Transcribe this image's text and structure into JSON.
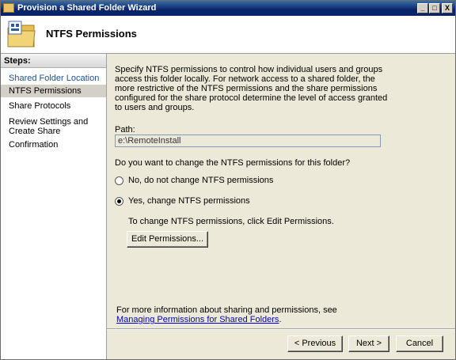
{
  "window": {
    "title": "Provision a Shared Folder Wizard",
    "controls": {
      "minimize": "_",
      "maximize": "□",
      "close": "X"
    }
  },
  "header": {
    "title": "NTFS Permissions",
    "icon": "folder-icon"
  },
  "steps": {
    "heading": "Steps:",
    "items": [
      {
        "label": "Shared Folder Location",
        "state": "done"
      },
      {
        "label": "NTFS Permissions",
        "state": "active"
      },
      {
        "label": "Share Protocols",
        "state": "pending"
      },
      {
        "label": "Review Settings and Create Share",
        "state": "pending"
      },
      {
        "label": "Confirmation",
        "state": "pending"
      }
    ]
  },
  "content": {
    "description": "Specify NTFS permissions to control how individual users and groups access this folder locally. For network access to a shared folder, the more restrictive of the NTFS permissions and the share permissions configured for the share protocol determine the level of access granted to users and groups.",
    "path_label": "Path:",
    "path_value": "e:\\RemoteInstall",
    "question": "Do you want to change the NTFS permissions for this folder?",
    "option_no": "No, do not change NTFS permissions",
    "option_yes": "Yes, change NTFS permissions",
    "selected_option": "yes",
    "hint": "To change NTFS permissions, click Edit Permissions.",
    "edit_button": "Edit Permissions...",
    "info_prefix": "For more information about sharing and permissions, see ",
    "info_link": "Managing Permissions for Shared Folders",
    "info_suffix": "."
  },
  "footer": {
    "previous": "< Previous",
    "next": "Next >",
    "cancel": "Cancel"
  }
}
